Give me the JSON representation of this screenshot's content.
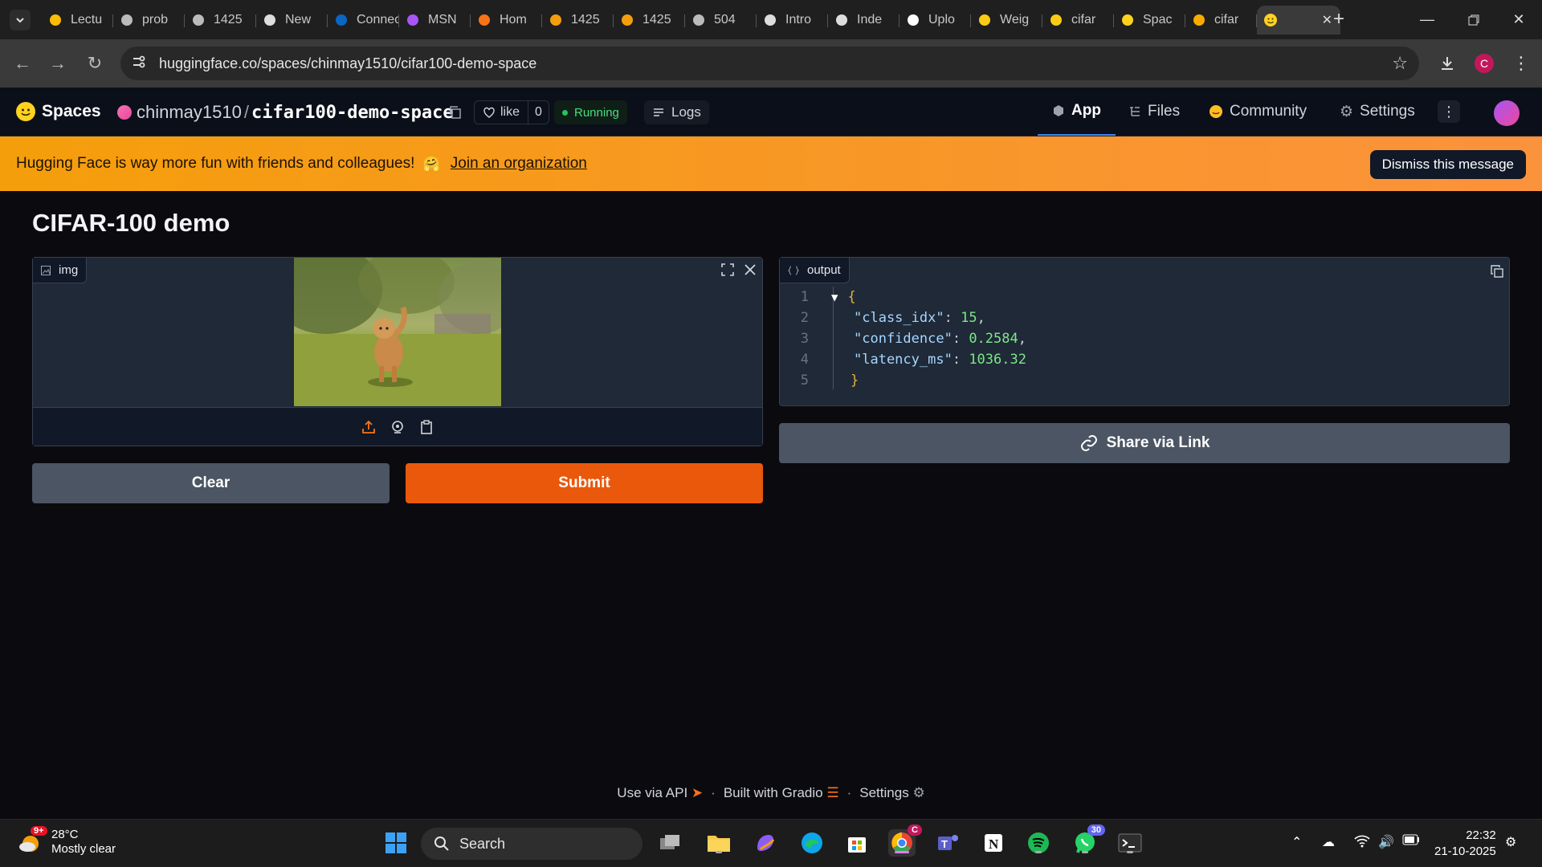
{
  "browser": {
    "tabs": [
      {
        "label": "Lectu",
        "icon": "google-drive-icon"
      },
      {
        "label": "prob",
        "icon": "globe-icon"
      },
      {
        "label": "1425",
        "icon": "globe-icon"
      },
      {
        "label": "New",
        "icon": "openai-icon"
      },
      {
        "label": "Connect",
        "icon": "linkedin-icon"
      },
      {
        "label": "MSN",
        "icon": "copilot-icon"
      },
      {
        "label": "Hom",
        "icon": "coursera-icon"
      },
      {
        "label": "1425",
        "icon": "book-icon"
      },
      {
        "label": "1425",
        "icon": "book-icon"
      },
      {
        "label": "504",
        "icon": "globe-icon"
      },
      {
        "label": "Intro",
        "icon": "chatgpt-icon"
      },
      {
        "label": "Inde",
        "icon": "openai-icon"
      },
      {
        "label": "Uplo",
        "icon": "github-icon"
      },
      {
        "label": "Weig",
        "icon": "wandb-icon"
      },
      {
        "label": "cifar",
        "icon": "wandb-icon"
      },
      {
        "label": "Spac",
        "icon": "huggingface-icon"
      },
      {
        "label": "cifar",
        "icon": "colab-icon"
      }
    ],
    "active_tab_icon": "huggingface-icon",
    "url": "huggingface.co/spaces/chinmay1510/cifar100-demo-space",
    "profile_initial": "C"
  },
  "hf_header": {
    "brand": "Spaces",
    "owner": "chinmay1510",
    "repo": "cifar100-demo-space",
    "like_label": "like",
    "like_count": "0",
    "status": "Running",
    "logs_label": "Logs",
    "nav": {
      "app": "App",
      "files": "Files",
      "community": "Community",
      "settings": "Settings"
    }
  },
  "banner": {
    "message": "Hugging Face is way more fun with friends and colleagues!",
    "emoji": "🤗",
    "link": "Join an organization",
    "dismiss": "Dismiss this message"
  },
  "app": {
    "title": "CIFAR-100 demo",
    "input_label": "img",
    "output_label": "output",
    "output_lines": [
      {
        "n": "1",
        "text": "{"
      },
      {
        "n": "2",
        "key": "\"class_idx\"",
        "value": "15"
      },
      {
        "n": "3",
        "key": "\"confidence\"",
        "value": "0.2584"
      },
      {
        "n": "4",
        "key": "\"latency_ms\"",
        "value": "1036.32"
      },
      {
        "n": "5",
        "text": "}"
      }
    ],
    "share_label": "Share via Link",
    "clear_label": "Clear",
    "submit_label": "Submit"
  },
  "footer": {
    "api": "Use via API",
    "built": "Built with Gradio",
    "settings": "Settings"
  },
  "taskbar": {
    "temp": "28°C",
    "weather": "Mostly clear",
    "weather_badge": "9+",
    "search_placeholder": "Search",
    "whatsapp_badge": "30",
    "chrome_badge": "C",
    "time": "22:32",
    "date": "21-10-2025"
  }
}
